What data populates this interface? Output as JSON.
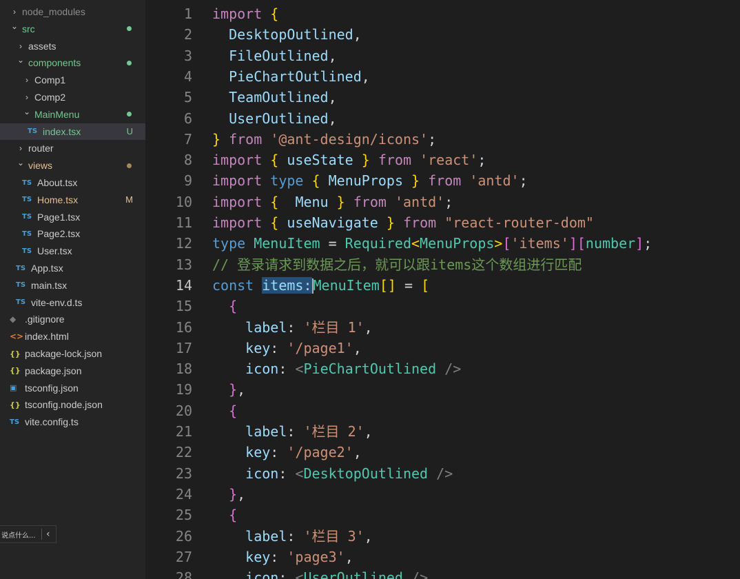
{
  "explorer": {
    "items": [
      {
        "label": "node_modules",
        "type": "folder",
        "open": false,
        "level": 1,
        "color": "dim"
      },
      {
        "label": "src",
        "type": "folder",
        "open": true,
        "level": 1,
        "color": "green",
        "dot": "green"
      },
      {
        "label": "assets",
        "type": "folder",
        "open": false,
        "level": 2
      },
      {
        "label": "components",
        "type": "folder",
        "open": true,
        "level": 2,
        "color": "green",
        "dot": "green"
      },
      {
        "label": "Comp1",
        "type": "folder",
        "open": false,
        "level": 3
      },
      {
        "label": "Comp2",
        "type": "folder",
        "open": false,
        "level": 3
      },
      {
        "label": "MainMenu",
        "type": "folder",
        "open": true,
        "level": 3,
        "color": "green",
        "dot": "green"
      },
      {
        "label": "index.tsx",
        "type": "ts",
        "level": 4,
        "color": "green",
        "badge": "U",
        "badge_color": "green",
        "selected": true
      },
      {
        "label": "router",
        "type": "folder",
        "open": false,
        "level": 2
      },
      {
        "label": "views",
        "type": "folder",
        "open": true,
        "level": 2,
        "color": "yellow",
        "dot": "yellow"
      },
      {
        "label": "About.tsx",
        "type": "ts",
        "level": 3
      },
      {
        "label": "Home.tsx",
        "type": "ts",
        "level": 3,
        "color": "yellow",
        "badge": "M",
        "badge_color": "yellow"
      },
      {
        "label": "Page1.tsx",
        "type": "ts",
        "level": 3
      },
      {
        "label": "Page2.tsx",
        "type": "ts",
        "level": 3
      },
      {
        "label": "User.tsx",
        "type": "ts",
        "level": 3
      },
      {
        "label": "App.tsx",
        "type": "ts",
        "level": 2
      },
      {
        "label": "main.tsx",
        "type": "ts",
        "level": 2
      },
      {
        "label": "vite-env.d.ts",
        "type": "ts",
        "level": 2
      },
      {
        "label": ".gitignore",
        "type": "git",
        "level": 1
      },
      {
        "label": "index.html",
        "type": "html",
        "level": 1
      },
      {
        "label": "package-lock.json",
        "type": "json",
        "level": 1
      },
      {
        "label": "package.json",
        "type": "json",
        "level": 1
      },
      {
        "label": "tsconfig.json",
        "type": "tsjson",
        "level": 1
      },
      {
        "label": "tsconfig.node.json",
        "type": "json",
        "level": 1
      },
      {
        "label": "vite.config.ts",
        "type": "ts",
        "level": 1
      }
    ],
    "icon_text": {
      "ts": "TS",
      "html": "<>",
      "json": "{}",
      "git": "◆",
      "tsjson": "▣"
    }
  },
  "bottom_pill": {
    "text": "说点什么...",
    "collapse_icon": "‹"
  },
  "editor": {
    "active_line": 14,
    "lines": [
      {
        "n": "1",
        "tokens": [
          [
            "kw2",
            "import"
          ],
          [
            "pun",
            " "
          ],
          [
            "br1",
            "{"
          ]
        ]
      },
      {
        "n": "2",
        "tokens": [
          [
            "pun",
            "  "
          ],
          [
            "id",
            "DesktopOutlined"
          ],
          [
            "pun",
            ","
          ]
        ]
      },
      {
        "n": "3",
        "tokens": [
          [
            "pun",
            "  "
          ],
          [
            "id",
            "FileOutlined"
          ],
          [
            "pun",
            ","
          ]
        ]
      },
      {
        "n": "4",
        "tokens": [
          [
            "pun",
            "  "
          ],
          [
            "id",
            "PieChartOutlined"
          ],
          [
            "pun",
            ","
          ]
        ]
      },
      {
        "n": "5",
        "tokens": [
          [
            "pun",
            "  "
          ],
          [
            "id",
            "TeamOutlined"
          ],
          [
            "pun",
            ","
          ]
        ]
      },
      {
        "n": "6",
        "tokens": [
          [
            "pun",
            "  "
          ],
          [
            "id",
            "UserOutlined"
          ],
          [
            "pun",
            ","
          ]
        ]
      },
      {
        "n": "7",
        "tokens": [
          [
            "br1",
            "}"
          ],
          [
            "pun",
            " "
          ],
          [
            "kw2",
            "from"
          ],
          [
            "pun",
            " "
          ],
          [
            "str",
            "'@ant-design/icons'"
          ],
          [
            "pun",
            ";"
          ]
        ]
      },
      {
        "n": "8",
        "tokens": [
          [
            "kw2",
            "import"
          ],
          [
            "pun",
            " "
          ],
          [
            "br1",
            "{"
          ],
          [
            "pun",
            " "
          ],
          [
            "id",
            "useState"
          ],
          [
            "pun",
            " "
          ],
          [
            "br1",
            "}"
          ],
          [
            "pun",
            " "
          ],
          [
            "kw2",
            "from"
          ],
          [
            "pun",
            " "
          ],
          [
            "str",
            "'react'"
          ],
          [
            "pun",
            ";"
          ]
        ]
      },
      {
        "n": "9",
        "tokens": [
          [
            "kw2",
            "import"
          ],
          [
            "pun",
            " "
          ],
          [
            "kw",
            "type"
          ],
          [
            "pun",
            " "
          ],
          [
            "br1",
            "{"
          ],
          [
            "pun",
            " "
          ],
          [
            "id",
            "MenuProps"
          ],
          [
            "pun",
            " "
          ],
          [
            "br1",
            "}"
          ],
          [
            "pun",
            " "
          ],
          [
            "kw2",
            "from"
          ],
          [
            "pun",
            " "
          ],
          [
            "str",
            "'antd'"
          ],
          [
            "pun",
            ";"
          ]
        ]
      },
      {
        "n": "10",
        "tokens": [
          [
            "kw2",
            "import"
          ],
          [
            "pun",
            " "
          ],
          [
            "br1",
            "{"
          ],
          [
            "pun",
            "  "
          ],
          [
            "id",
            "Menu"
          ],
          [
            "pun",
            " "
          ],
          [
            "br1",
            "}"
          ],
          [
            "pun",
            " "
          ],
          [
            "kw2",
            "from"
          ],
          [
            "pun",
            " "
          ],
          [
            "str",
            "'antd'"
          ],
          [
            "pun",
            ";"
          ]
        ]
      },
      {
        "n": "11",
        "tokens": [
          [
            "kw2",
            "import"
          ],
          [
            "pun",
            " "
          ],
          [
            "br1",
            "{"
          ],
          [
            "pun",
            " "
          ],
          [
            "id",
            "useNavigate"
          ],
          [
            "pun",
            " "
          ],
          [
            "br1",
            "}"
          ],
          [
            "pun",
            " "
          ],
          [
            "kw2",
            "from"
          ],
          [
            "pun",
            " "
          ],
          [
            "str",
            "\"react-router-dom\""
          ]
        ]
      },
      {
        "n": "12",
        "tokens": [
          [
            "kw",
            "type"
          ],
          [
            "pun",
            " "
          ],
          [
            "ty",
            "MenuItem"
          ],
          [
            "pun",
            " = "
          ],
          [
            "ty",
            "Required"
          ],
          [
            "br1",
            "<"
          ],
          [
            "ty",
            "MenuProps"
          ],
          [
            "br1",
            ">"
          ],
          [
            "br2",
            "["
          ],
          [
            "str",
            "'items'"
          ],
          [
            "br2",
            "]"
          ],
          [
            "br2",
            "["
          ],
          [
            "ty",
            "number"
          ],
          [
            "br2",
            "]"
          ],
          [
            "pun",
            ";"
          ]
        ]
      },
      {
        "n": "13",
        "tokens": [
          [
            "cm",
            "// 登录请求到数据之后，就可以跟items这个数组进行匹配"
          ]
        ]
      },
      {
        "n": "14",
        "tokens": [
          [
            "kw",
            "const"
          ],
          [
            "pun",
            " "
          ],
          [
            "selid",
            "items:"
          ],
          [
            "cursor",
            ""
          ],
          [
            "ty",
            "MenuItem"
          ],
          [
            "br1",
            "[]"
          ],
          [
            "pun",
            " = "
          ],
          [
            "br1",
            "["
          ]
        ]
      },
      {
        "n": "15",
        "tokens": [
          [
            "pun",
            "  "
          ],
          [
            "br2",
            "{"
          ]
        ]
      },
      {
        "n": "16",
        "tokens": [
          [
            "pun",
            "    "
          ],
          [
            "id",
            "label"
          ],
          [
            "pun",
            ": "
          ],
          [
            "str",
            "'栏目 1'"
          ],
          [
            "pun",
            ","
          ]
        ]
      },
      {
        "n": "17",
        "tokens": [
          [
            "pun",
            "    "
          ],
          [
            "id",
            "key"
          ],
          [
            "pun",
            ": "
          ],
          [
            "str",
            "'/page1'"
          ],
          [
            "pun",
            ","
          ]
        ]
      },
      {
        "n": "18",
        "tokens": [
          [
            "pun",
            "    "
          ],
          [
            "id",
            "icon"
          ],
          [
            "pun",
            ": "
          ],
          [
            "tag",
            "<"
          ],
          [
            "comp",
            "PieChartOutlined"
          ],
          [
            "pun",
            " "
          ],
          [
            "tag",
            "/>"
          ]
        ]
      },
      {
        "n": "19",
        "tokens": [
          [
            "pun",
            "  "
          ],
          [
            "br2",
            "}"
          ],
          [
            "pun",
            ","
          ]
        ]
      },
      {
        "n": "20",
        "tokens": [
          [
            "pun",
            "  "
          ],
          [
            "br2",
            "{"
          ]
        ]
      },
      {
        "n": "21",
        "tokens": [
          [
            "pun",
            "    "
          ],
          [
            "id",
            "label"
          ],
          [
            "pun",
            ": "
          ],
          [
            "str",
            "'栏目 2'"
          ],
          [
            "pun",
            ","
          ]
        ]
      },
      {
        "n": "22",
        "tokens": [
          [
            "pun",
            "    "
          ],
          [
            "id",
            "key"
          ],
          [
            "pun",
            ": "
          ],
          [
            "str",
            "'/page2'"
          ],
          [
            "pun",
            ","
          ]
        ]
      },
      {
        "n": "23",
        "tokens": [
          [
            "pun",
            "    "
          ],
          [
            "id",
            "icon"
          ],
          [
            "pun",
            ": "
          ],
          [
            "tag",
            "<"
          ],
          [
            "comp",
            "DesktopOutlined"
          ],
          [
            "pun",
            " "
          ],
          [
            "tag",
            "/>"
          ]
        ]
      },
      {
        "n": "24",
        "tokens": [
          [
            "pun",
            "  "
          ],
          [
            "br2",
            "}"
          ],
          [
            "pun",
            ","
          ]
        ]
      },
      {
        "n": "25",
        "tokens": [
          [
            "pun",
            "  "
          ],
          [
            "br2",
            "{"
          ]
        ]
      },
      {
        "n": "26",
        "tokens": [
          [
            "pun",
            "    "
          ],
          [
            "id",
            "label"
          ],
          [
            "pun",
            ": "
          ],
          [
            "str",
            "'栏目 3'"
          ],
          [
            "pun",
            ","
          ]
        ]
      },
      {
        "n": "27",
        "tokens": [
          [
            "pun",
            "    "
          ],
          [
            "id",
            "key"
          ],
          [
            "pun",
            ": "
          ],
          [
            "str",
            "'page3'"
          ],
          [
            "pun",
            ","
          ]
        ]
      },
      {
        "n": "28",
        "tokens": [
          [
            "pun",
            "    "
          ],
          [
            "id",
            "icon"
          ],
          [
            "pun",
            ": "
          ],
          [
            "tag",
            "<"
          ],
          [
            "comp",
            "UserOutlined"
          ],
          [
            "pun",
            " "
          ],
          [
            "tag",
            "/>"
          ]
        ]
      }
    ]
  }
}
